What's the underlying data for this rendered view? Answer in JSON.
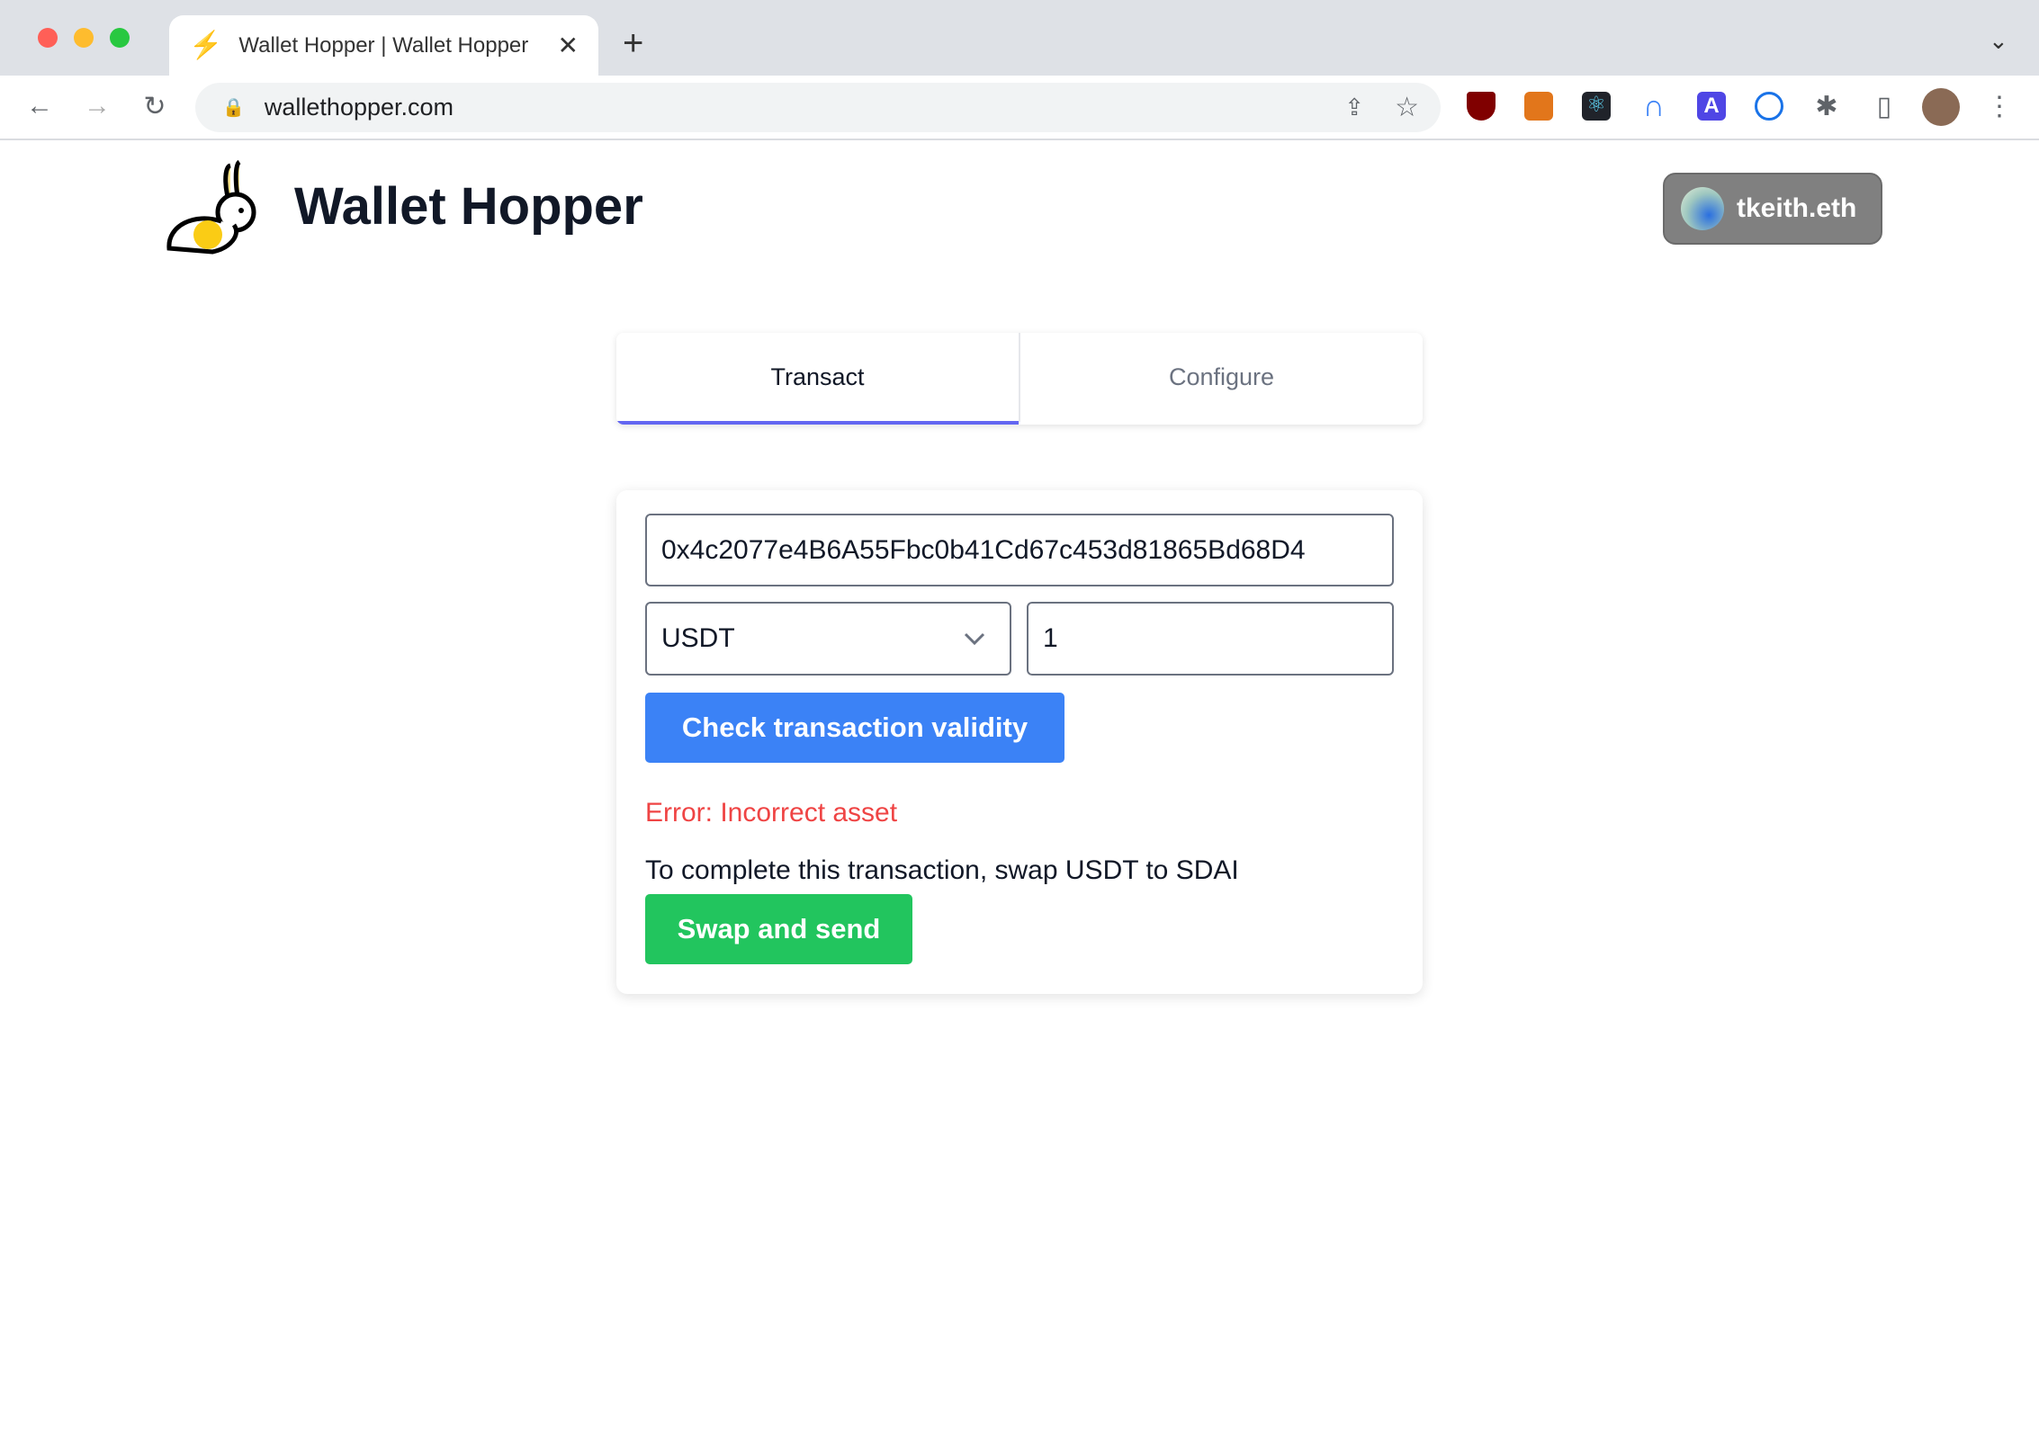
{
  "browser": {
    "tab_title": "Wallet Hopper | Wallet Hopper",
    "url": "wallethopper.com",
    "extensions": [
      "ublock-icon",
      "metamask-icon",
      "react-devtools-icon",
      "arc-icon",
      "a-icon",
      "1password-icon"
    ]
  },
  "header": {
    "title": "Wallet Hopper",
    "account": "tkeith.eth"
  },
  "tabs": [
    {
      "label": "Transact"
    },
    {
      "label": "Configure"
    }
  ],
  "form": {
    "address": "0x4c2077e4B6A55Fbc0b41Cd67c453d81865Bd68D4",
    "asset": "USDT",
    "amount": "1",
    "check_label": "Check transaction validity",
    "error": "Error: Incorrect asset",
    "instruction": "To complete this transaction, swap USDT to SDAI",
    "swap_label": "Swap and send"
  },
  "colors": {
    "primary": "#3b82f6",
    "success": "#22c55e",
    "error": "#ef4444",
    "tab_indicator": "#6366f1"
  }
}
